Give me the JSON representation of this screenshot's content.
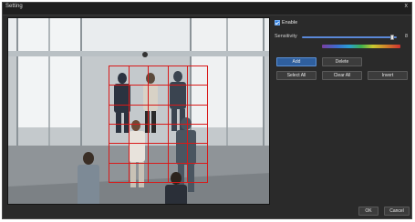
{
  "window": {
    "title": "Setting",
    "close_glyph": "x"
  },
  "panel": {
    "enable_label": "Enable",
    "enable_checked": true,
    "sensitivity_label": "Sensitivity",
    "sensitivity_value": "8",
    "sensitivity_level": 0.95,
    "buttons": {
      "add": "Add",
      "delete": "Delete",
      "select_all": "Select All",
      "clear_all": "Clear All",
      "invert": "Invert"
    }
  },
  "footer": {
    "ok": "OK",
    "cancel": "Cancel"
  },
  "detection_grid": {
    "rows": 6,
    "cols": 5
  },
  "colors": {
    "grid": "#d81a1a",
    "accent": "#2f7fe0"
  }
}
